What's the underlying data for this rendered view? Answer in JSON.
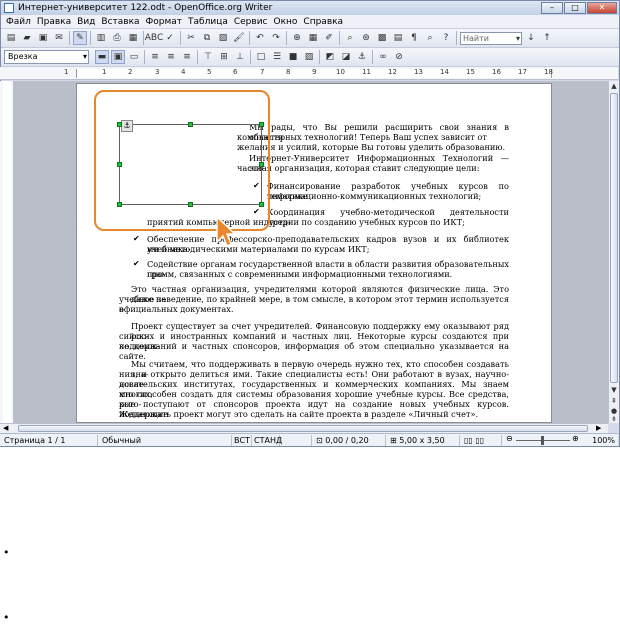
{
  "window": {
    "title": "Интернет-университет 122.odt - OpenOffice.org Writer"
  },
  "menu": [
    "Файл",
    "Правка",
    "Вид",
    "Вставка",
    "Формат",
    "Таблица",
    "Сервис",
    "Окно",
    "Справка"
  ],
  "toolbar": {
    "find_placeholder": "Найти"
  },
  "formatting": {
    "style": "Врезка"
  },
  "ruler": {
    "ticks": [
      "1",
      "1",
      "2",
      "3",
      "4",
      "5",
      "6",
      "7",
      "8",
      "9",
      "10",
      "11",
      "12",
      "13",
      "14",
      "15",
      "16",
      "17",
      "18"
    ]
  },
  "document": {
    "lines": [
      "Мы рады, что Вы решили расширить свои знания в области",
      "компьютерных технологий! Теперь Ваш успех зависит от",
      "желания и усилий, которые Вы готовы уделить образованию.",
      "Интернет-Университет Информационных Технологий — это",
      "частная организация, которая ставит следующие цели:",
      "Финансирование разработок учебных курсов по тематике",
      "информационно-коммуникационных технологий;",
      "Координация учебно-методической деятельности пред-",
      "приятий компьютерной индустрии по созданию учебных курсов по ИКТ;",
      "Обеспечение профессорско-преподавательских кадров вузов и их библиотек учебника-",
      "ми и методическими материалами по курсам ИКТ;",
      "Содействие органам государственной власти в области развития образовательных про-",
      "грамм, связанных с современными информационными технологиями.",
      "Это частная организация, учредителями которой являются физические лица. Это даже не",
      "учебное заведение, по крайней мере, в том смысле, в котором этот термин используется в",
      "официальных документах.",
      "Проект существует за счет учредителей. Финансовую поддержку ему оказывают ряд рос-",
      "сийских и иностранных компаний и частных лиц. Некоторые курсы создаются при поддерж-",
      "ке компаний и частных спонсоров, информация об этом специально указывается на сайте.",
      "Мы считаем, что поддерживать в первую очередь нужно тех, кто способен создавать зна-",
      "ния, и открыто делиться ими. Такие специалисты есть! Они работают в вузах, научно-иссле-",
      "довательских институтах, государственных и коммерческих компаниях. Мы знаем многих,",
      "кто способен создать для системы образования хорошие учебные курсы. Все средства, кото-",
      "рые поступают от спонсоров проекта идут на создание новых учебных курсов. Желающие",
      "поддержать проект могут это сделать на сайте проекта в разделе «Личный счет»."
    ]
  },
  "status": {
    "page": "Страница 1 / 1",
    "style": "Обычный",
    "insert": "ВСТ",
    "select": "СТАНД",
    "position": "0,00 / 0,20",
    "size": "5,00 x 3,50",
    "zoom": "100%"
  },
  "colors": {
    "highlight": "#e8862a",
    "handle": "#23c13b"
  }
}
